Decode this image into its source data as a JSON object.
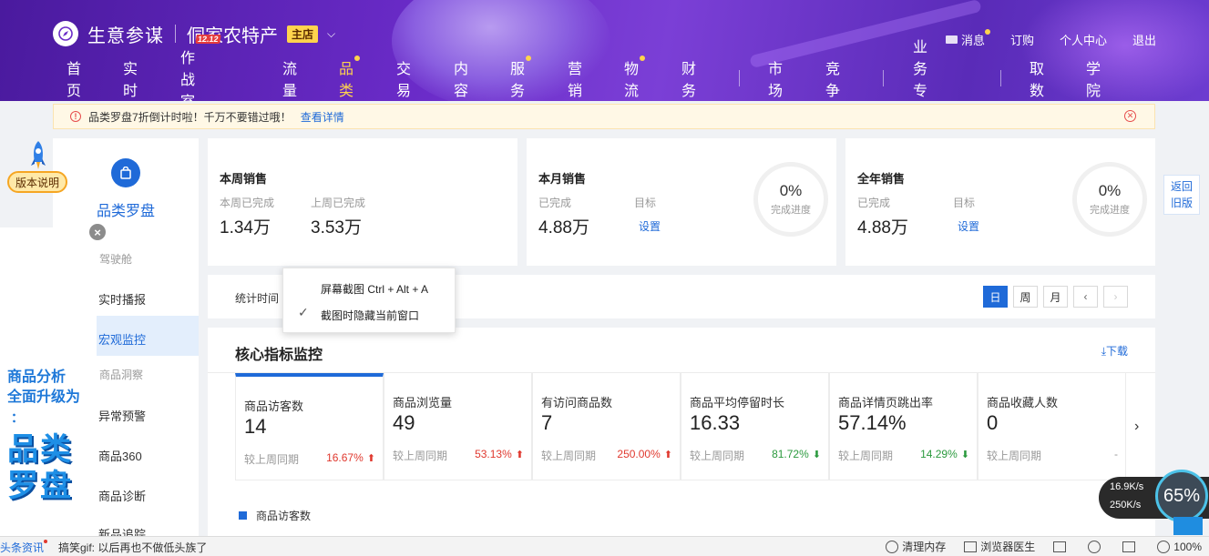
{
  "header": {
    "brand_title": "生意参谋",
    "shop_name": "侗家农特产",
    "shop_badge": "主店",
    "top_links": {
      "message": "消息",
      "subscribe": "订购",
      "personal": "个人中心",
      "logout": "退出"
    },
    "nav": [
      "首页",
      "实时",
      "作战室",
      "流量",
      "品类",
      "交易",
      "内容",
      "服务",
      "营销",
      "物流",
      "财务",
      "市场",
      "竞争",
      "业务专区",
      "取数",
      "学院"
    ],
    "badge_1212": "12.12",
    "active_nav": "品类"
  },
  "notice": {
    "text": "品类罗盘7折倒计时啦！千万不要错过哦！",
    "link": "查看详情"
  },
  "float_widget": {
    "version_label": "版本说明"
  },
  "sidebar": {
    "title": "品类罗盘",
    "items": {
      "cockpit": "驾驶舱",
      "realtime": "实时播报",
      "macro": "宏观监控",
      "insight": "商品洞察",
      "alert": "异常预警",
      "p360": "商品360",
      "diagnose": "商品诊断",
      "newtrack": "新品追踪"
    }
  },
  "promo": {
    "line1": "商品分析",
    "line2": "全面升级为",
    "line3": "：",
    "big1": "品类",
    "big2": "罗盘"
  },
  "cards": {
    "week": {
      "title": "本周销售",
      "label1": "本周已完成",
      "value1": "1.34万",
      "label2": "上周已完成",
      "value2": "3.53万"
    },
    "month": {
      "title": "本月销售",
      "label1": "已完成",
      "value1": "4.88万",
      "label2": "目标",
      "link": "设置",
      "gauge_value": "0%",
      "gauge_label": "完成进度"
    },
    "year": {
      "title": "全年销售",
      "label1": "已完成",
      "value1": "4.88万",
      "label2": "目标",
      "link": "设置",
      "gauge_value": "0%",
      "gauge_label": "完成进度"
    }
  },
  "old_version": {
    "line1": "返回",
    "line2": "旧版"
  },
  "timebar": {
    "label": "统计时间",
    "periods": [
      "日",
      "周",
      "月"
    ],
    "prev": "‹",
    "next": "›"
  },
  "context_menu": {
    "item1": "屏幕截图 Ctrl + Alt + A",
    "item2": "截图时隐藏当前窗口",
    "check": "✓"
  },
  "metrics": {
    "title": "核心指标监控",
    "download": "⤓下载",
    "compare_label": "较上周同期",
    "items": [
      {
        "name": "商品访客数",
        "value": "14",
        "pct": "16.67%",
        "trend": "up"
      },
      {
        "name": "商品浏览量",
        "value": "49",
        "pct": "53.13%",
        "trend": "up"
      },
      {
        "name": "有访问商品数",
        "value": "7",
        "pct": "250.00%",
        "trend": "up"
      },
      {
        "name": "商品平均停留时长",
        "value": "16.33",
        "pct": "81.72%",
        "trend": "down"
      },
      {
        "name": "商品详情页跳出率",
        "value": "57.14%",
        "pct": "14.29%",
        "trend": "down"
      },
      {
        "name": "商品收藏人数",
        "value": "0",
        "pct": "-",
        "trend": "none"
      }
    ],
    "legend": "商品访客数"
  },
  "speed_widget": {
    "up": "16.9K/s",
    "down": "250K/s",
    "percent": "65%"
  },
  "statusbar": {
    "news": "头条资讯",
    "ticker": "搞笑gif: 以后再也不做低头族了",
    "clean": "清理内存",
    "doctor": "浏览器医生",
    "zoom": "100%"
  },
  "colors": {
    "accent": "#1f6ad8",
    "up": "#e0382e",
    "down": "#2b9a3e",
    "highlight": "#ffd34d"
  }
}
